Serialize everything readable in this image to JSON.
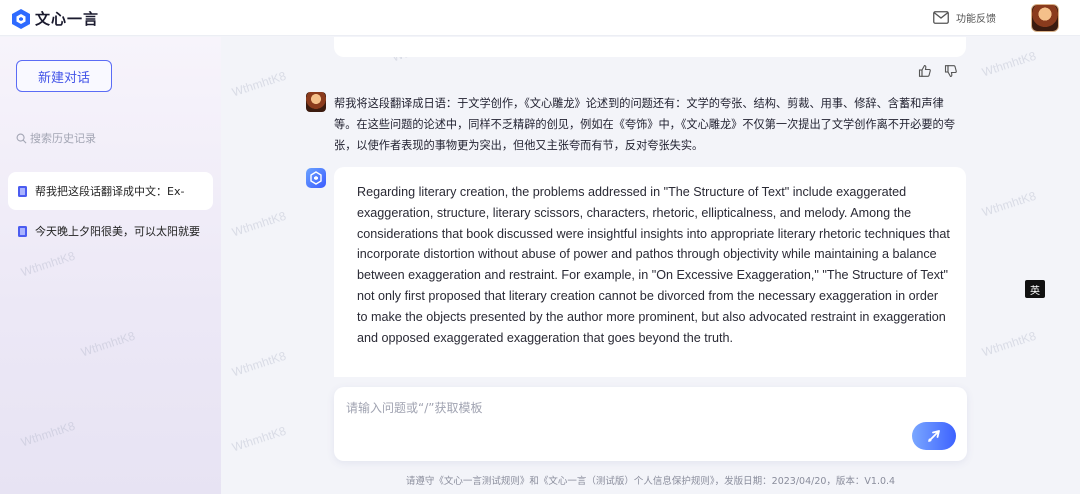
{
  "app": {
    "title": "文心一言"
  },
  "header": {
    "feedback_label": "功能反馈"
  },
  "sidebar": {
    "new_chat_label": "新建对话",
    "search_placeholder": "搜索历史记录",
    "history": [
      {
        "label": "帮我把这段话翻译成中文：Ex-",
        "active": true
      },
      {
        "label": "今天晚上夕阳很美，可以太阳就要",
        "active": false
      }
    ]
  },
  "conversation": {
    "user_message": "帮我将这段翻译成日语：于文学创作，《文心雕龙》论述到的问题还有：文学的夸张、结构、剪裁、用事、修辞、含蓄和声律等。在这些问题的论述中，同样不乏精辟的创见，例如在《夸饰》中，《文心雕龙》不仅第一次提出了文学创作离不开必要的夸张，以使作者表现的事物更为突出，但他又主张夸而有节，反对夸张失实。",
    "bot_reply": "Regarding literary creation, the problems addressed in \"The Structure of Text\" include exaggerated exaggeration, structure, literary scissors, characters, rhetoric, ellipticalness, and melody. Among the considerations that book discussed were insightful insights into appropriate literary rhetoric techniques that incorporate distortion without abuse of power and pathos through objectivity while maintaining a balance between exaggeration and restraint. For example, in \"On Excessive Exaggeration,\" \"The Structure of Text\" not only first proposed that literary creation cannot be divorced from the necessary exaggeration in order to make the objects presented by the author more prominent, but also advocated restraint in exaggeration and opposed exaggerated exaggeration that goes beyond the truth."
  },
  "lang_badge": "英",
  "input": {
    "placeholder": "请输入问题或“/”获取模板"
  },
  "footer": {
    "note": "请遵守《文心一言测试规则》和《文心一言（测试版）个人信息保护规则》，发版日期：2023/04/20，版本：V1.0.4"
  },
  "watermark": "WthmhtK8",
  "colors": {
    "accent": "#4354e8",
    "send_gradient_start": "#7aa7ff",
    "send_gradient_end": "#3d62ff"
  }
}
